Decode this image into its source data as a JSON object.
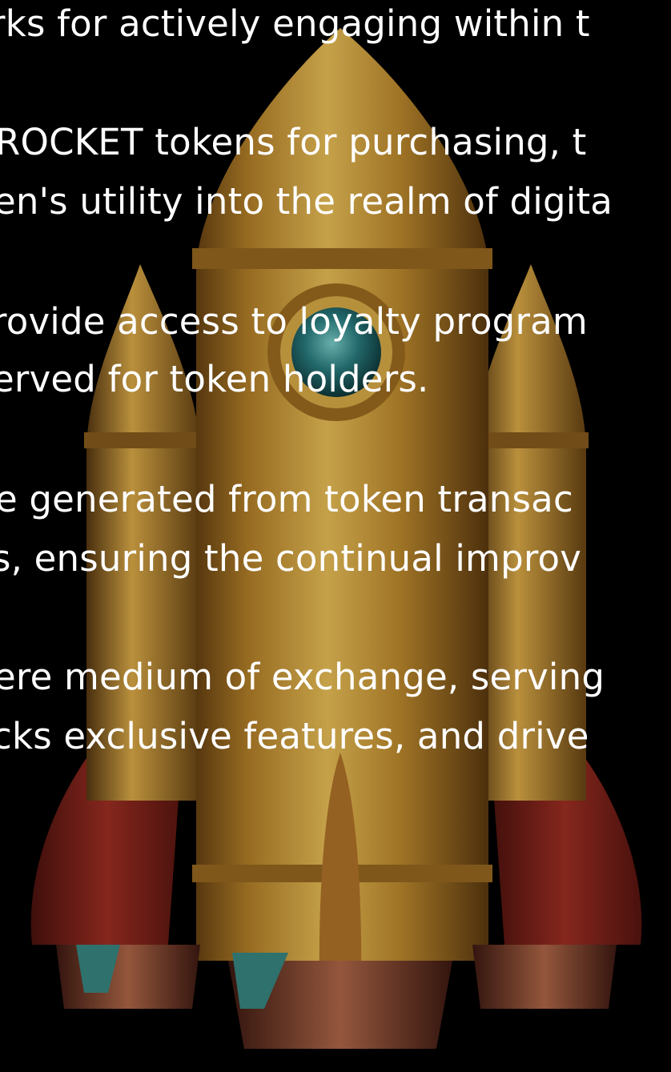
{
  "paragraphs": [
    {
      "lines": [
        "rks for actively engaging within t"
      ]
    },
    {
      "lines": [
        "ROCKET tokens for purchasing, t",
        "en's utility into the realm of digita"
      ]
    },
    {
      "lines": [
        "rovide access to loyalty program",
        "erved for token holders."
      ]
    },
    {
      "lines": [
        "e generated from token transac",
        "s, ensuring the continual improv"
      ]
    },
    {
      "lines": [
        "ere medium of exchange, serving",
        "cks exclusive features, and drive"
      ]
    }
  ],
  "colors": {
    "background": "#000000",
    "text": "#ffffff",
    "rocket_gold": "#d9a43a",
    "rocket_red": "#9a2a22",
    "window_teal": "#2f8f8f"
  }
}
